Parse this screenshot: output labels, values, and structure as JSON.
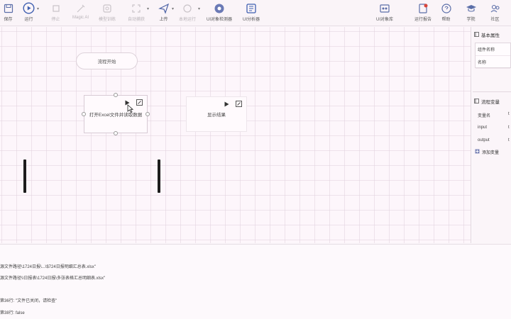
{
  "toolbar": {
    "items": [
      {
        "label": "保存",
        "icon": "save-icon"
      },
      {
        "label": "运行",
        "icon": "play-circle-icon"
      },
      {
        "label": "停止",
        "icon": "stop-icon"
      },
      {
        "label": "Magic AI",
        "icon": "magic-ai-icon"
      },
      {
        "label": "模型训练",
        "icon": "model-training-icon"
      },
      {
        "label": "自动捕获",
        "icon": "capture-icon"
      },
      {
        "label": "上传",
        "icon": "send-icon"
      },
      {
        "label": "本地运行",
        "icon": "local-run-icon"
      },
      {
        "label": "UI对象检测器",
        "icon": "ui-detector-icon"
      },
      {
        "label": "UI分析器",
        "icon": "ui-analyzer-icon"
      }
    ],
    "right_items": [
      {
        "label": "UI对象库",
        "icon": "object-library-icon"
      },
      {
        "label": "运行报告",
        "icon": "report-icon"
      },
      {
        "label": "帮助",
        "icon": "help-icon"
      },
      {
        "label": "学院",
        "icon": "academy-icon"
      },
      {
        "label": "社区",
        "icon": "community-icon"
      }
    ]
  },
  "canvas": {
    "start_label": "流程开始",
    "node1_label": "打开Excel文件并读取数据",
    "node2_label": "显示结果"
  },
  "right_panel": {
    "props_title": "基本属性",
    "props_rows": [
      "组件名称",
      "名称"
    ],
    "vars_title": "流程变量",
    "vars": [
      {
        "name": "变量名",
        "value": "t"
      },
      {
        "name": "input",
        "value": "t"
      },
      {
        "name": "output",
        "value": "t"
      }
    ],
    "add_var": "添加变量"
  },
  "log": {
    "lines": [
      "源文件路径\\1724日报\\...\\$724日报明细汇总表.xlsx\"",
      "源文件路径\\\\日报表\\1724日报\\多张表格汇总明细表.xlsx\"",
      "第36行:  \"文件已关闭，请检查\"",
      "第38行:  false"
    ]
  }
}
